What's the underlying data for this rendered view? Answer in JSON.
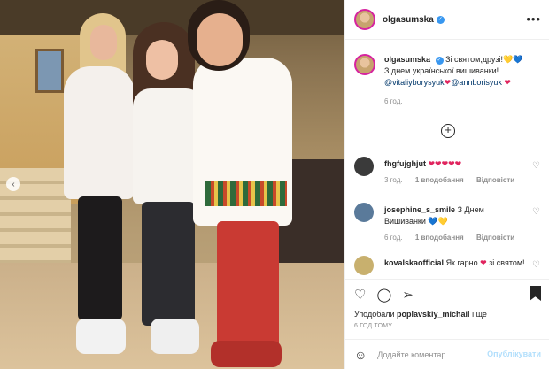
{
  "post": {
    "username": "olgasumska",
    "more_icon": "more-horizontal-icon"
  },
  "caption": {
    "username": "olgasumska",
    "text_line1": "Зі святом,друзі!",
    "text_line1_hearts": "💛💙",
    "text_line2": "З днем української вишиванки!",
    "mention1": "@vitaliyborysyuk",
    "mention2": "@annborisyuk",
    "time": "6 год."
  },
  "comments": [
    {
      "username": "fhgfujghjut",
      "text": "❤❤❤❤❤",
      "time": "3 год.",
      "likes": "1 вподобання",
      "reply": "Відповісти"
    },
    {
      "username": "josephine_s_smile",
      "text": "З Днем Вишиванки",
      "hearts": "💙💛",
      "time": "6 год.",
      "likes": "1 вподобання",
      "reply": "Відповісти"
    },
    {
      "username": "kovalskaofficial",
      "text": "Як гарно",
      "text_after": "зі святом!"
    }
  ],
  "actions": {
    "liked_prefix": "Уподобали",
    "liked_user": "poplavskiy_michail",
    "liked_suffix": "і ще",
    "time_ago": "6 ГОД ТОМУ"
  },
  "add_comment": {
    "placeholder": "Додайте коментар...",
    "publish_label": "Опублікувати"
  },
  "colors": {
    "accent": "#3897f0",
    "heart": "#e0245e",
    "publish_disabled": "#b2dffc"
  }
}
